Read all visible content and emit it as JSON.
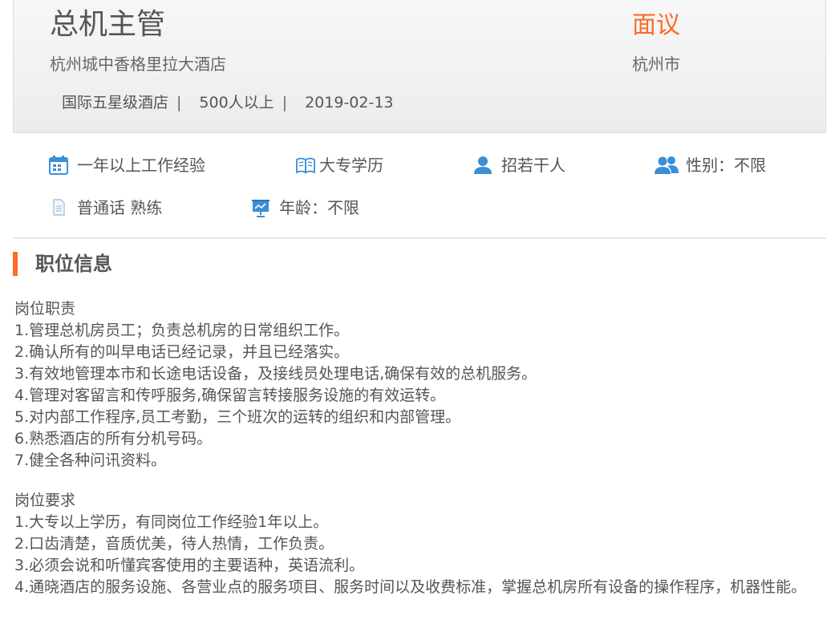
{
  "job": {
    "title": "总机主管",
    "salary": "面议",
    "company": "杭州城中香格里拉大酒店",
    "city": "杭州市",
    "meta": {
      "company_type": "国际五星级酒店",
      "size": "500人以上",
      "date": "2019-02-13",
      "separator": "|"
    }
  },
  "attributes": {
    "experience": "一年以上工作经验",
    "education": "大专学历",
    "headcount": "招若干人",
    "gender": "性别：不限",
    "language": "普通话 熟练",
    "age": "年龄：不限"
  },
  "icons": {
    "experience": "calendar-icon",
    "education": "book-icon",
    "headcount": "person-icon",
    "gender": "people-icon",
    "language": "document-icon",
    "age": "presentation-icon"
  },
  "colors": {
    "accent": "#ff6a28",
    "icon_blue": "#3a8fd6"
  },
  "section": {
    "title": "职位信息"
  },
  "duties": {
    "heading": "岗位职责",
    "items": [
      "1.管理总机房员工；负责总机房的日常组织工作。",
      "2.确认所有的叫早电话已经记录，并且已经落实。",
      "3.有效地管理本市和长途电话设备，及接线员处理电话,确保有效的总机服务。",
      "4.管理对客留言和传呼服务,确保留言转接服务设施的有效运转。",
      "5.对内部工作程序,员工考勤，三个班次的运转的组织和内部管理。",
      "6.熟悉酒店的所有分机号码。",
      "7.健全各种问讯资料。"
    ]
  },
  "requirements": {
    "heading": "岗位要求",
    "items": [
      "1.大专以上学历，有同岗位工作经验1年以上。",
      "2.口齿清楚，音质优美，待人热情，工作负责。",
      "3.必须会说和听懂宾客使用的主要语种，英语流利。",
      "4.通晓酒店的服务设施、各营业点的服务项目、服务时间以及收费标准，掌握总机房所有设备的操作程序，机器性能。"
    ]
  }
}
